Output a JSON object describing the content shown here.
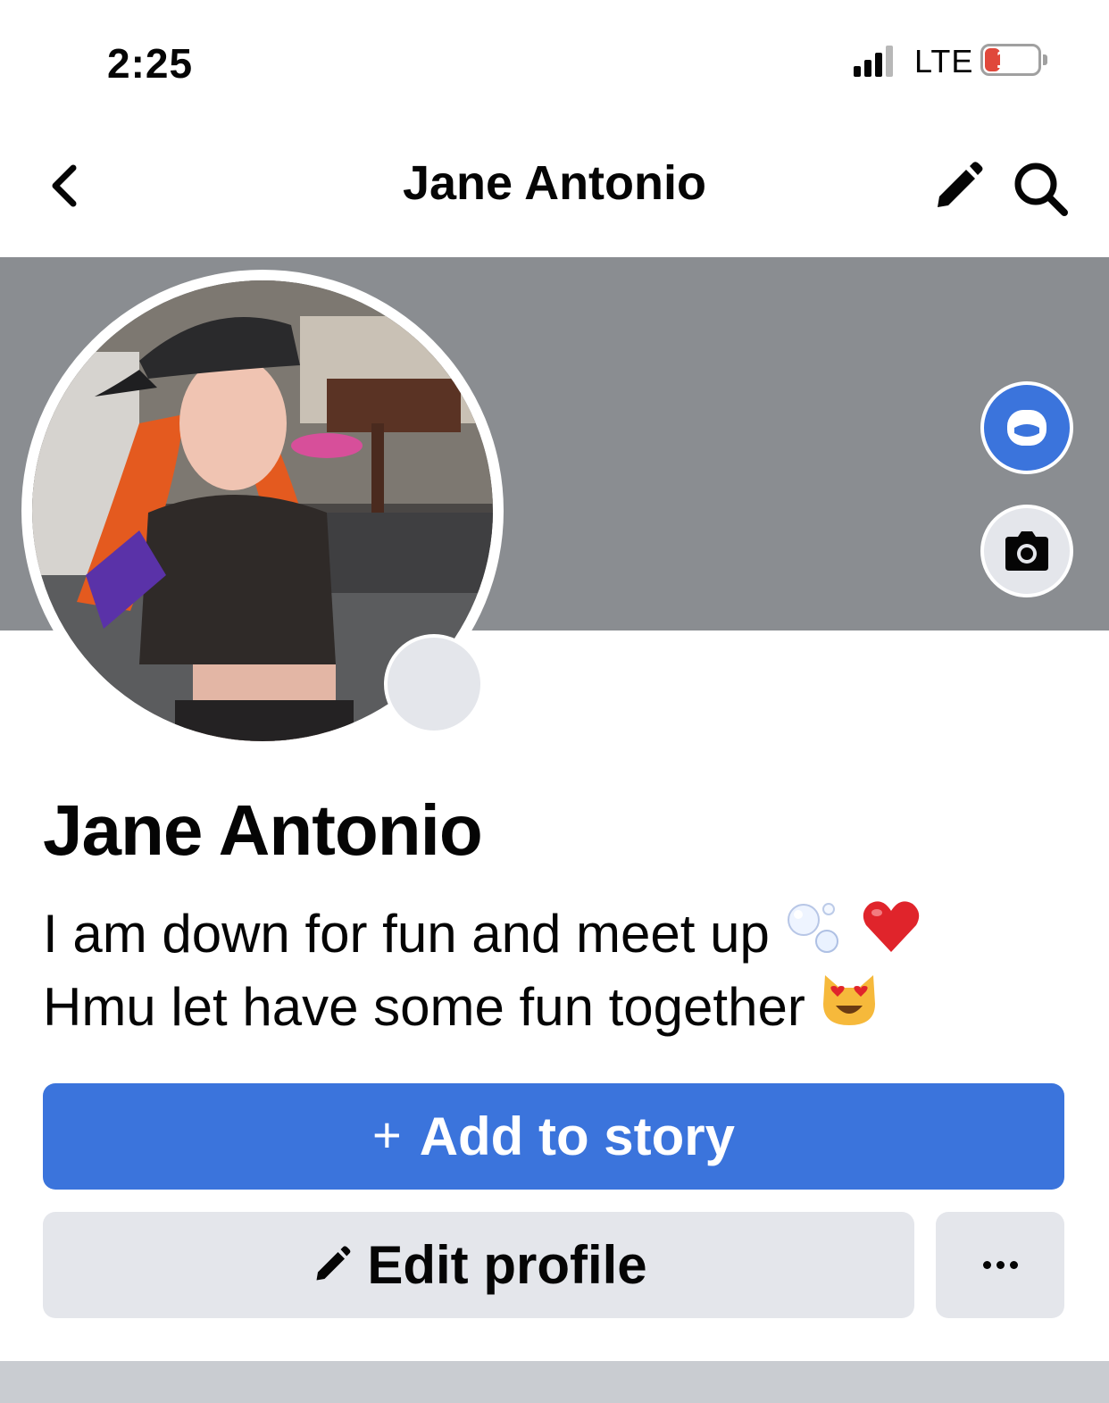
{
  "status_bar": {
    "time": "2:25",
    "network": "LTE",
    "battery": "13",
    "battery_level": 0.13
  },
  "nav": {
    "title": "Jane Antonio",
    "icons": [
      "chevron-left-icon",
      "pencil-icon",
      "search-icon"
    ]
  },
  "profile": {
    "name": "Jane Antonio",
    "bio_line_1": "I am down for fun and meet up",
    "bio_line_1_emojis": [
      "bubbles-emoji",
      "red-heart-emoji"
    ],
    "bio_line_2": "Hmu let have some fun together",
    "bio_line_2_emojis": [
      "heart-eyes-cat-emoji"
    ]
  },
  "actions": {
    "add_story_icon": "+",
    "add_story_label": "Add to story",
    "edit_profile_label": "Edit profile",
    "more_icon": "ellipsis-icon"
  },
  "colors": {
    "accent": "#3b74dc",
    "cover": "#8a8d91",
    "button_secondary": "#e4e6eb",
    "battery_low": "#e0483b"
  }
}
